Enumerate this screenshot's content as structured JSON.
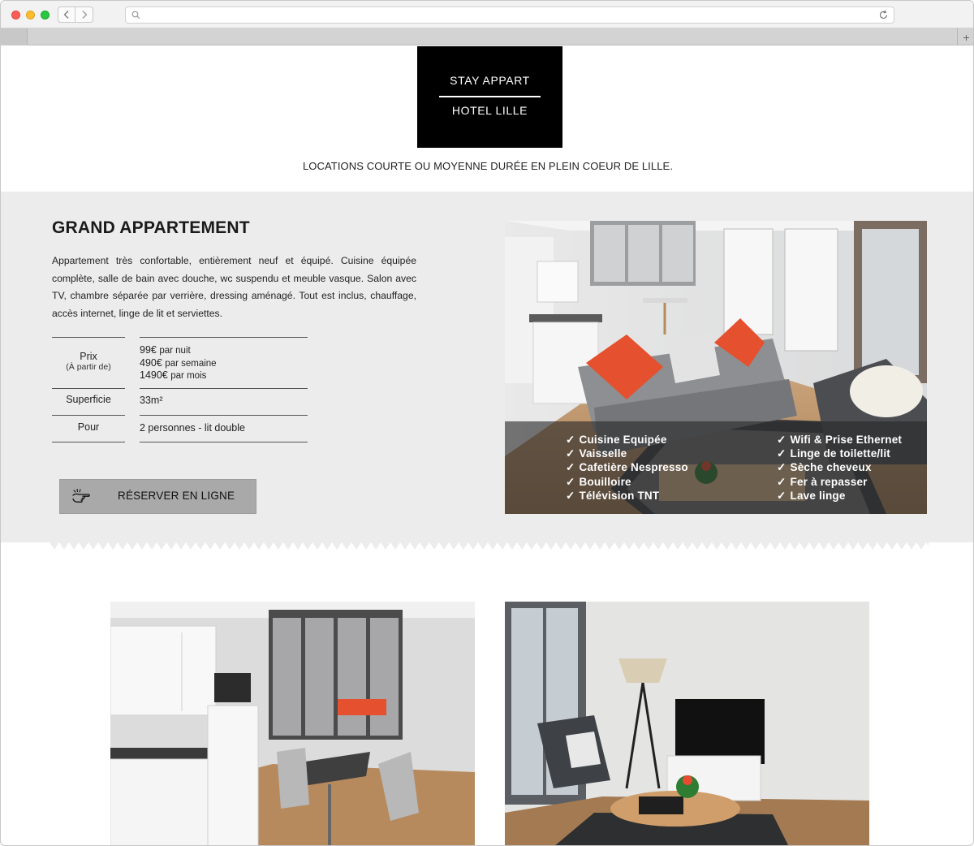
{
  "browser": {
    "url": "",
    "new_tab": "+"
  },
  "header": {
    "logo_line1": "STAY APPART",
    "logo_line2": "HOTEL LILLE",
    "tagline": "LOCATIONS COURTE OU MOYENNE DURÉE EN PLEIN COEUR DE LILLE."
  },
  "listing": {
    "title": "GRAND APPARTEMENT",
    "description": "Appartement très confortable, entièrement neuf et équipé. Cuisine équipée complète, salle de bain avec douche, wc suspendu et meuble vasque. Salon avec TV, chambre séparée par verrière, dressing aménagé. Tout est inclus, chauffage, accès internet, linge de lit et serviettes.",
    "specs": {
      "price_label": "Prix",
      "price_sublabel": "(À partir de)",
      "price_night_amount": "99€",
      "price_night_unit": "par nuit",
      "price_week_amount": "490€",
      "price_week_unit": "par semaine",
      "price_month_amount": "1490€",
      "price_month_unit": "par mois",
      "area_label": "Superficie",
      "area_value": "33m²",
      "guests_label": "Pour",
      "guests_value": "2 personnes - lit double"
    },
    "book_button": "RÉSERVER EN LIGNE"
  },
  "amenities": {
    "check": "✓",
    "left": [
      "Cuisine Equipée",
      "Vaisselle",
      "Cafetière Nespresso",
      "Bouilloire",
      "Télévision TNT"
    ],
    "right": [
      "Wifi & Prise Ethernet",
      "Linge de toilette/lit",
      "Sèche cheveux",
      "Fer à repasser",
      "Lave linge"
    ]
  },
  "colors": {
    "band": "#ececec",
    "logo_bg": "#000000",
    "button_bg": "#a9a9a9",
    "accent_cushion": "#e5502e"
  },
  "icons": {
    "book_button": "hand-pointer-icon"
  }
}
